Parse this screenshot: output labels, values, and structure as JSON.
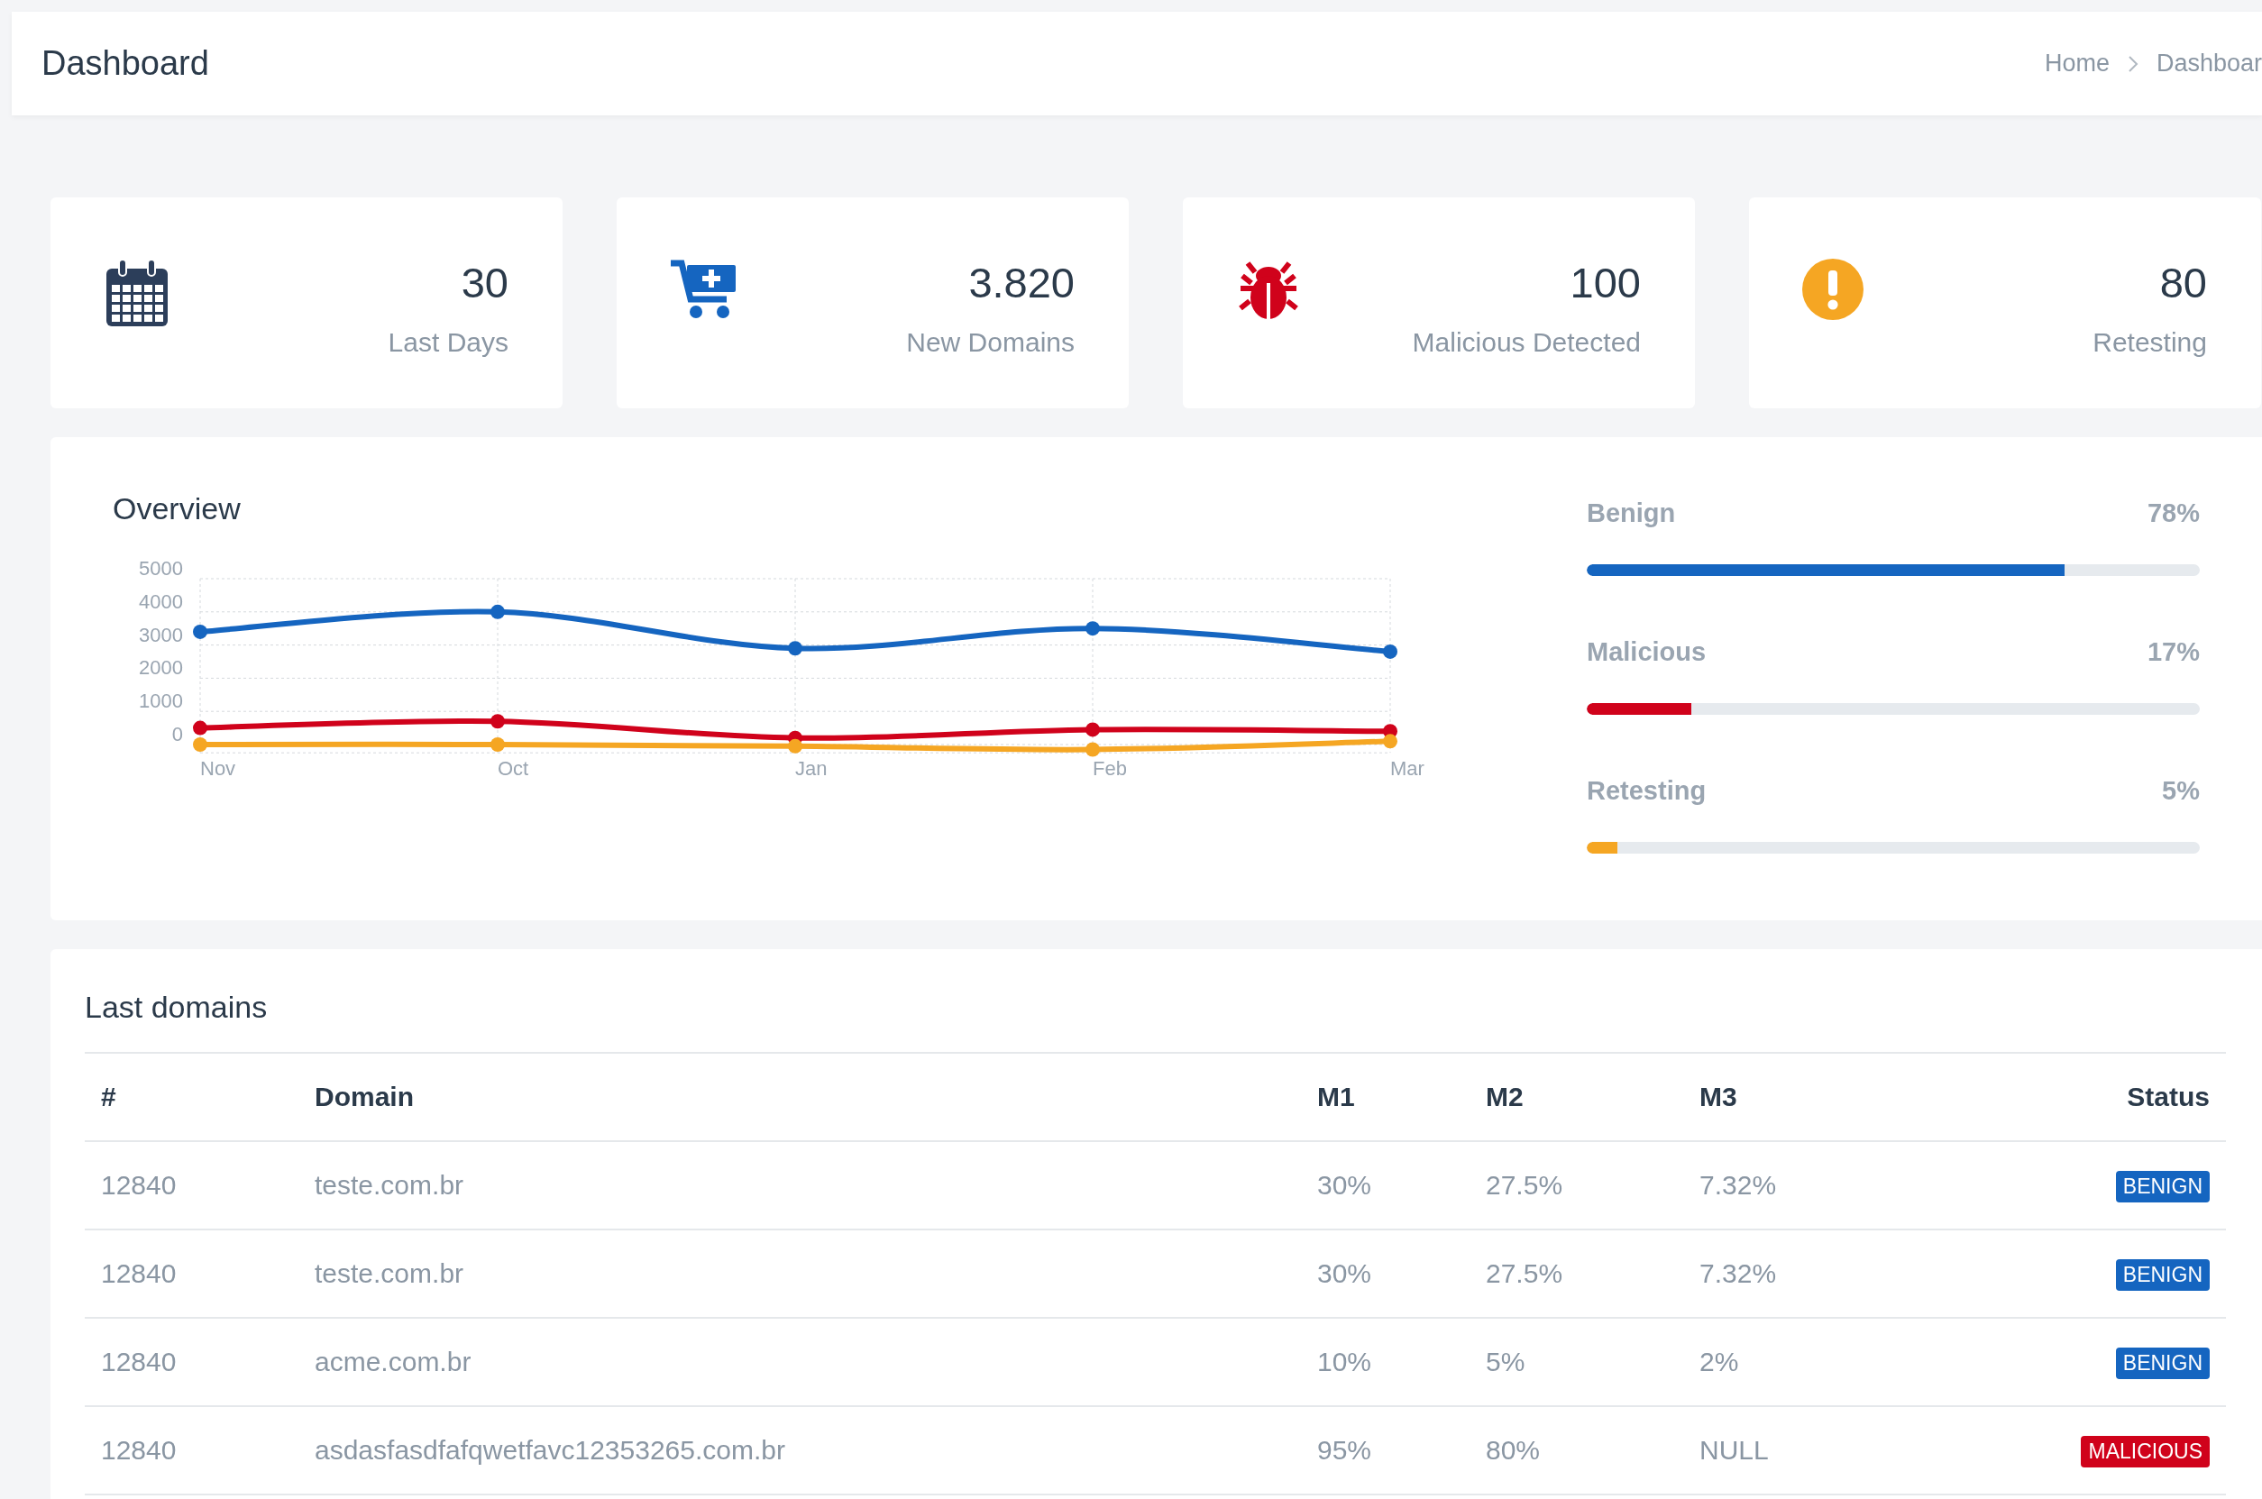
{
  "header": {
    "title": "Dashboard",
    "breadcrumb": [
      "Home",
      "Dashboar"
    ]
  },
  "stats": [
    {
      "kind": "calendar",
      "value": "30",
      "label": "Last Days"
    },
    {
      "kind": "cart",
      "value": "3.820",
      "label": "New Domains"
    },
    {
      "kind": "bug",
      "value": "100",
      "label": "Malicious Detected"
    },
    {
      "kind": "alert",
      "value": "80",
      "label": "Retesting"
    }
  ],
  "overview": {
    "title": "Overview",
    "chart_data": {
      "type": "line",
      "categories": [
        "Nov",
        "Oct",
        "Jan",
        "Feb",
        "Mar"
      ],
      "ylim": [
        -250,
        5000
      ],
      "grid": true,
      "yticks": [
        0,
        1000,
        2000,
        3000,
        4000,
        5000
      ],
      "series": [
        {
          "color": "#1565c0",
          "marker": "circle",
          "values": [
            3400,
            4000,
            2900,
            3500,
            2800
          ]
        },
        {
          "color": "#d0021b",
          "marker": "circle",
          "values": [
            500,
            700,
            200,
            450,
            400
          ]
        },
        {
          "color": "#f5a623",
          "marker": "circle",
          "values": [
            0,
            0,
            -50,
            -150,
            100
          ]
        }
      ]
    },
    "breakdown": [
      {
        "label": "Benign",
        "reading": "78%",
        "level": 0.78,
        "color": "#1565c0"
      },
      {
        "label": "Malicious",
        "reading": "17%",
        "level": 0.17,
        "color": "#d0021b"
      },
      {
        "label": "Retesting",
        "reading": "5%",
        "level": 0.05,
        "color": "#f5a623"
      }
    ]
  },
  "table": {
    "title": "Last domains",
    "columns": [
      "#",
      "Domain",
      "M1",
      "M2",
      "M3",
      "Status"
    ],
    "rows": [
      {
        "id": "12840",
        "domain": "teste.com.br",
        "m1": "30%",
        "m2": "27.5%",
        "m3": "7.32%",
        "status": {
          "label": "BENIGN",
          "kind": "benign"
        }
      },
      {
        "id": "12840",
        "domain": "teste.com.br",
        "m1": "30%",
        "m2": "27.5%",
        "m3": "7.32%",
        "status": {
          "label": "BENIGN",
          "kind": "benign"
        }
      },
      {
        "id": "12840",
        "domain": "acme.com.br",
        "m1": "10%",
        "m2": "5%",
        "m3": "2%",
        "status": {
          "label": "BENIGN",
          "kind": "benign"
        }
      },
      {
        "id": "12840",
        "domain": "asdasfasdfafqwetfavc12353265.com.br",
        "m1": "95%",
        "m2": "80%",
        "m3": "NULL",
        "status": {
          "label": "MALICIOUS",
          "kind": "malicious"
        }
      }
    ]
  }
}
